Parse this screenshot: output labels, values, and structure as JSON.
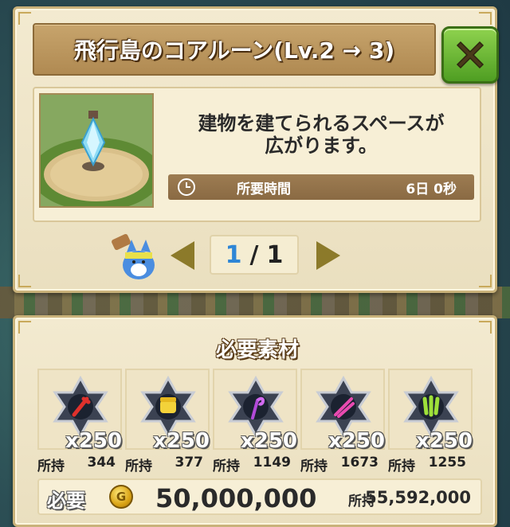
{
  "dialog": {
    "title": "飛行島のコアルーン(Lv.2 → 3)",
    "description_line1": "建物を建てられるスペースが",
    "description_line2": "広がります。",
    "time_label": "所要時間",
    "time_value": "6日 0秒"
  },
  "pager": {
    "current": "1",
    "separator": "/",
    "total": "1"
  },
  "materials_section": {
    "title": "必要素材",
    "items": [
      {
        "icon": "red-sword-rune-icon",
        "required": "x250",
        "owned_label": "所持",
        "owned": "344"
      },
      {
        "icon": "yellow-fist-rune-icon",
        "required": "x250",
        "owned_label": "所持",
        "owned": "377"
      },
      {
        "icon": "purple-staff-rune-icon",
        "required": "x250",
        "owned_label": "所持",
        "owned": "1149"
      },
      {
        "icon": "pink-blades-rune-icon",
        "required": "x250",
        "owned_label": "所持",
        "owned": "1673"
      },
      {
        "icon": "green-claw-rune-icon",
        "required": "x250",
        "owned_label": "所持",
        "owned": "1255"
      }
    ]
  },
  "cost": {
    "need_label": "必要",
    "coin_symbol": "G",
    "need_amount": "50,000,000",
    "own_label": "所持",
    "own_amount": "55,592,000"
  },
  "colors": {
    "accent_green": "#5fae2c",
    "page_current_blue": "#2e86d6",
    "panel_bg": "#f3ead0"
  }
}
